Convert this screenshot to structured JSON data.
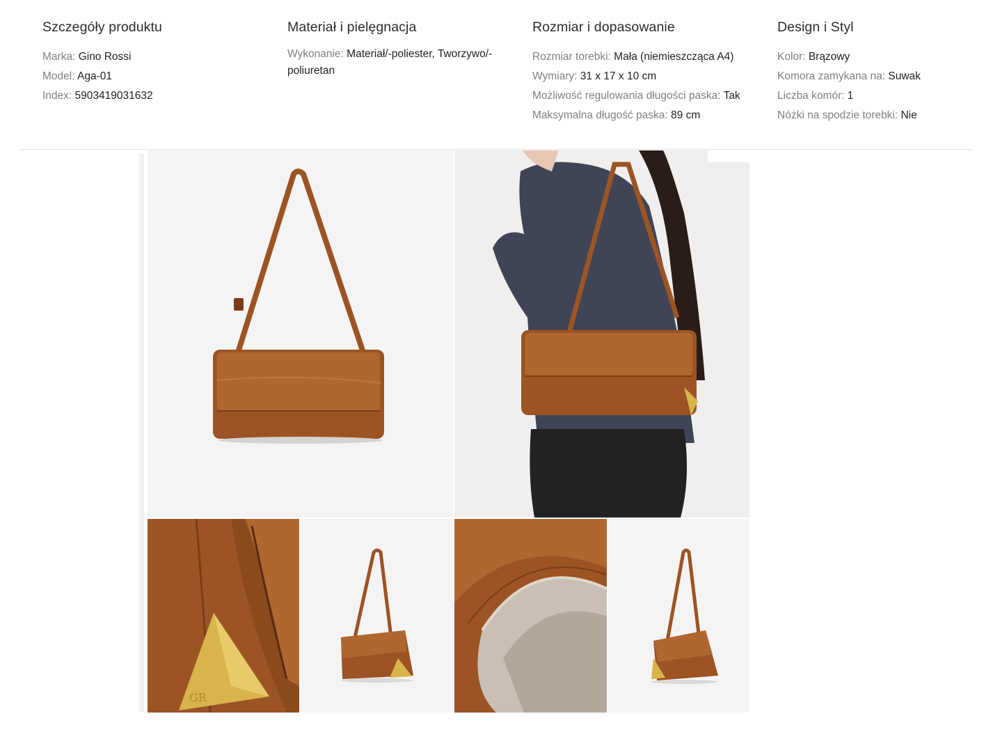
{
  "sections": [
    {
      "title": "Szczegóły produktu",
      "rows": [
        {
          "key": "Marka:",
          "value": "Gino Rossi"
        },
        {
          "key": "Model:",
          "value": "Aga-01"
        },
        {
          "key": "Index:",
          "value": "5903419031632"
        }
      ]
    },
    {
      "title": "Materiał i pielęgnacja",
      "rows": [
        {
          "key": "Wykonanie:",
          "value": "Materiał/-poliester, Tworzywo/-poliuretan"
        }
      ]
    },
    {
      "title": "Rozmiar i dopasowanie",
      "rows": [
        {
          "key": "Rozmiar torebki:",
          "value": "Mała (niemieszcząca A4)"
        },
        {
          "key": "Wymiary:",
          "value": "31 x 17 x 10 cm"
        },
        {
          "key": "Możliwość regulowania długości paska:",
          "value": "Tak"
        },
        {
          "key": "Maksymalna długość paska:",
          "value": "89 cm"
        }
      ]
    },
    {
      "title": "Design i Styl",
      "rows": [
        {
          "key": "Kolor:",
          "value": "Brązowy"
        },
        {
          "key": "Komora zamykana na:",
          "value": "Suwak"
        },
        {
          "key": "Liczba komór:",
          "value": "1"
        },
        {
          "key": "Nóżki na spodzie torebki:",
          "value": "Nie"
        }
      ]
    }
  ],
  "gallery": {
    "images": [
      {
        "name": "bag-front-image",
        "kind": "front"
      },
      {
        "name": "bag-model-image",
        "kind": "model"
      },
      {
        "name": "bag-closeup-triangle-image",
        "kind": "closeup-triangle"
      },
      {
        "name": "bag-side-image",
        "kind": "side"
      },
      {
        "name": "bag-interior-image",
        "kind": "interior"
      },
      {
        "name": "bag-back-image",
        "kind": "back"
      }
    ]
  },
  "colors": {
    "leather": "#9c5424",
    "leather_light": "#b86d35",
    "leather_dark": "#6e3614",
    "gold": "#d9b44a",
    "background_tile": "#f5f4f4"
  }
}
